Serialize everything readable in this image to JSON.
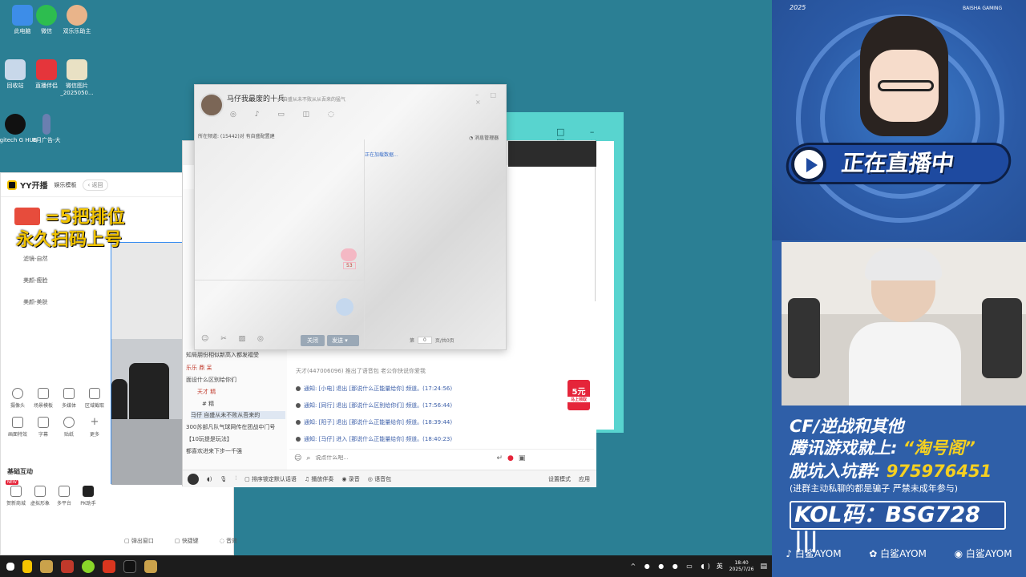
{
  "desktop": {
    "icons": [
      {
        "label": "此电脑"
      },
      {
        "label": "微信"
      },
      {
        "label": "双乐乐助主"
      },
      {
        "label": "回收站"
      },
      {
        "label": "直播伴侣"
      },
      {
        "label": "微信图片_2025050..."
      },
      {
        "label": "Logitech G HUB"
      },
      {
        "label": "8月广告-大"
      }
    ]
  },
  "yy": {
    "app_name": "YY开播",
    "mode": "娱乐模板",
    "back": "返回",
    "side_items": [
      "滤镜-自然",
      "美颜-瘦脸",
      "美颜-美肤"
    ],
    "tools_row1": [
      "摄像头",
      "场景模板",
      "多媒体",
      "区域截取"
    ],
    "tools_row2": [
      "画面特效",
      "字幕",
      "贴纸",
      "更多"
    ],
    "section_interactive": "基础互动",
    "tools_row3": [
      "贺新商城",
      "虚拟形象",
      "多平台",
      "PK助手"
    ],
    "new_badge": "NEW",
    "footer": [
      "弹出窗口",
      "快捷键",
      "音效"
    ]
  },
  "promo": {
    "line1": "=5把排位",
    "line2": "永久扫码上号"
  },
  "popup": {
    "title": "马仔我最废的十兵",
    "subtitle": "自盛从未不败从从吾来的猛气",
    "notice": "所在频道: (15442)对 有自盛配置建",
    "manager": "消息管理器",
    "loading": "正在加载数据...",
    "count_badge": "53",
    "btn_close": "关闭",
    "btn_send": "发送",
    "page_prefix": "第",
    "page_value": "0",
    "page_suffix": "页/共0页"
  },
  "chat": {
    "list_lines": [
      "知局朋份相似新高入都发福受",
      "乐乐 鼎 呆",
      "面设什么区别给你们",
      "天才 精",
      "# 精",
      "马仔 自盛从未不败从吾来的",
      "300苏部凡队气球网传在团战中门号",
      "【10玩提是玩法】",
      "都喜欢进来下步一千强"
    ],
    "system_line": "天才(447006096) 推出了语音包  老公你快说你爱我",
    "messages": [
      "通知: [小电] 退出 [那说什么正能量给你] 频道。(17:24:56)",
      "通知: [同行] 退出 [那说什么区别给你们] 频道。(17:56:44)",
      "通知: [阳子] 退出 [那说什么正能量给你] 频道。(18:39:44)",
      "通知: [马仔] 进入 [那说什么正能量给你] 频道。(18:40:23)"
    ],
    "input_placeholder": "说点什么吧...",
    "bottom": [
      "排序锁定默认话语",
      "播放伴奏",
      "录音",
      "语音包"
    ],
    "status": [
      "设置模式",
      "应用"
    ],
    "gift_price": "5元",
    "gift_sub": "马上领取"
  },
  "right": {
    "year": "2025",
    "brand": "BAISHA GAMING",
    "live": "正在直播中",
    "line1": "CF/逆战和其他",
    "line2_a": "腾讯游戏就上: ",
    "line2_b": "“淘号阁”",
    "line3_a": "脱坑入坑群: ",
    "line3_b": "975976451",
    "line4": "(进群主动私聊的都是骗子 严禁未成年参与)",
    "kol": "KOL码：BSG728",
    "social": [
      "白鲨AYOM",
      "白鲨AYOM",
      "白鲨AYOM"
    ]
  },
  "taskbar": {
    "ime": "英",
    "time": "18:40",
    "date": "2025/7/26"
  }
}
